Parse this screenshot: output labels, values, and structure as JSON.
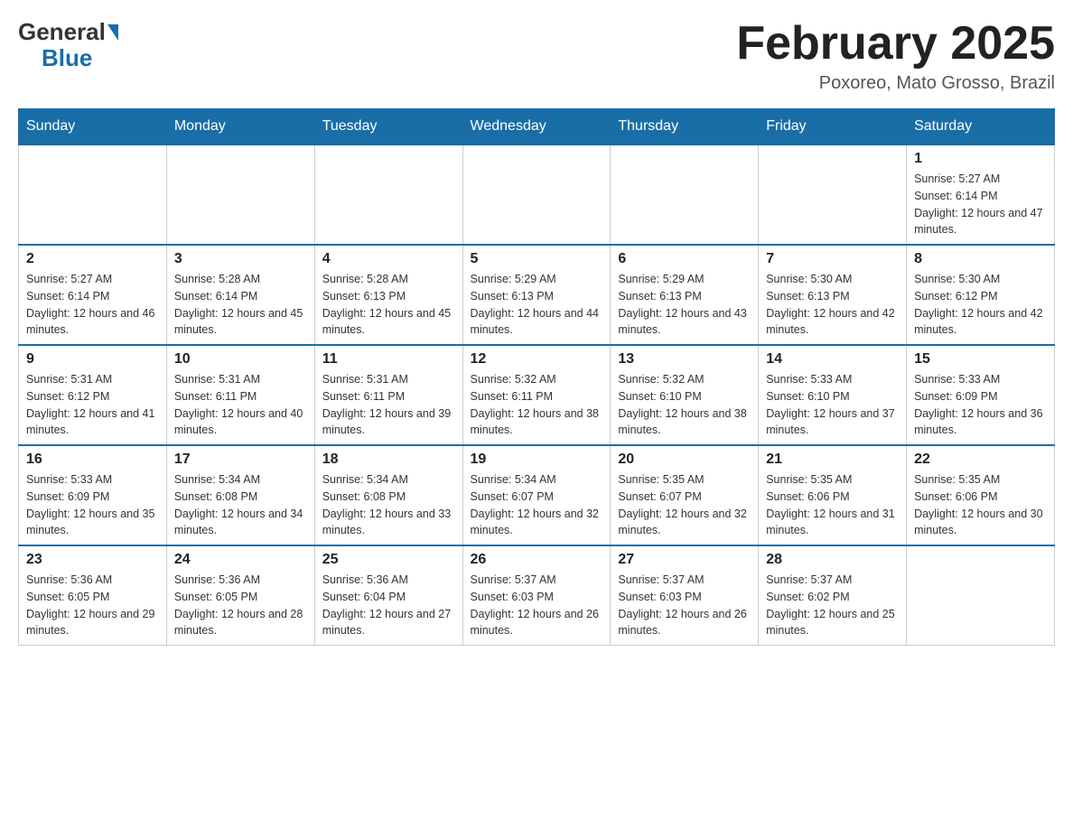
{
  "header": {
    "logo_general": "General",
    "logo_blue": "Blue",
    "title": "February 2025",
    "location": "Poxoreo, Mato Grosso, Brazil"
  },
  "weekdays": [
    "Sunday",
    "Monday",
    "Tuesday",
    "Wednesday",
    "Thursday",
    "Friday",
    "Saturday"
  ],
  "weeks": [
    [
      {
        "day": "",
        "info": ""
      },
      {
        "day": "",
        "info": ""
      },
      {
        "day": "",
        "info": ""
      },
      {
        "day": "",
        "info": ""
      },
      {
        "day": "",
        "info": ""
      },
      {
        "day": "",
        "info": ""
      },
      {
        "day": "1",
        "info": "Sunrise: 5:27 AM\nSunset: 6:14 PM\nDaylight: 12 hours and 47 minutes."
      }
    ],
    [
      {
        "day": "2",
        "info": "Sunrise: 5:27 AM\nSunset: 6:14 PM\nDaylight: 12 hours and 46 minutes."
      },
      {
        "day": "3",
        "info": "Sunrise: 5:28 AM\nSunset: 6:14 PM\nDaylight: 12 hours and 45 minutes."
      },
      {
        "day": "4",
        "info": "Sunrise: 5:28 AM\nSunset: 6:13 PM\nDaylight: 12 hours and 45 minutes."
      },
      {
        "day": "5",
        "info": "Sunrise: 5:29 AM\nSunset: 6:13 PM\nDaylight: 12 hours and 44 minutes."
      },
      {
        "day": "6",
        "info": "Sunrise: 5:29 AM\nSunset: 6:13 PM\nDaylight: 12 hours and 43 minutes."
      },
      {
        "day": "7",
        "info": "Sunrise: 5:30 AM\nSunset: 6:13 PM\nDaylight: 12 hours and 42 minutes."
      },
      {
        "day": "8",
        "info": "Sunrise: 5:30 AM\nSunset: 6:12 PM\nDaylight: 12 hours and 42 minutes."
      }
    ],
    [
      {
        "day": "9",
        "info": "Sunrise: 5:31 AM\nSunset: 6:12 PM\nDaylight: 12 hours and 41 minutes."
      },
      {
        "day": "10",
        "info": "Sunrise: 5:31 AM\nSunset: 6:11 PM\nDaylight: 12 hours and 40 minutes."
      },
      {
        "day": "11",
        "info": "Sunrise: 5:31 AM\nSunset: 6:11 PM\nDaylight: 12 hours and 39 minutes."
      },
      {
        "day": "12",
        "info": "Sunrise: 5:32 AM\nSunset: 6:11 PM\nDaylight: 12 hours and 38 minutes."
      },
      {
        "day": "13",
        "info": "Sunrise: 5:32 AM\nSunset: 6:10 PM\nDaylight: 12 hours and 38 minutes."
      },
      {
        "day": "14",
        "info": "Sunrise: 5:33 AM\nSunset: 6:10 PM\nDaylight: 12 hours and 37 minutes."
      },
      {
        "day": "15",
        "info": "Sunrise: 5:33 AM\nSunset: 6:09 PM\nDaylight: 12 hours and 36 minutes."
      }
    ],
    [
      {
        "day": "16",
        "info": "Sunrise: 5:33 AM\nSunset: 6:09 PM\nDaylight: 12 hours and 35 minutes."
      },
      {
        "day": "17",
        "info": "Sunrise: 5:34 AM\nSunset: 6:08 PM\nDaylight: 12 hours and 34 minutes."
      },
      {
        "day": "18",
        "info": "Sunrise: 5:34 AM\nSunset: 6:08 PM\nDaylight: 12 hours and 33 minutes."
      },
      {
        "day": "19",
        "info": "Sunrise: 5:34 AM\nSunset: 6:07 PM\nDaylight: 12 hours and 32 minutes."
      },
      {
        "day": "20",
        "info": "Sunrise: 5:35 AM\nSunset: 6:07 PM\nDaylight: 12 hours and 32 minutes."
      },
      {
        "day": "21",
        "info": "Sunrise: 5:35 AM\nSunset: 6:06 PM\nDaylight: 12 hours and 31 minutes."
      },
      {
        "day": "22",
        "info": "Sunrise: 5:35 AM\nSunset: 6:06 PM\nDaylight: 12 hours and 30 minutes."
      }
    ],
    [
      {
        "day": "23",
        "info": "Sunrise: 5:36 AM\nSunset: 6:05 PM\nDaylight: 12 hours and 29 minutes."
      },
      {
        "day": "24",
        "info": "Sunrise: 5:36 AM\nSunset: 6:05 PM\nDaylight: 12 hours and 28 minutes."
      },
      {
        "day": "25",
        "info": "Sunrise: 5:36 AM\nSunset: 6:04 PM\nDaylight: 12 hours and 27 minutes."
      },
      {
        "day": "26",
        "info": "Sunrise: 5:37 AM\nSunset: 6:03 PM\nDaylight: 12 hours and 26 minutes."
      },
      {
        "day": "27",
        "info": "Sunrise: 5:37 AM\nSunset: 6:03 PM\nDaylight: 12 hours and 26 minutes."
      },
      {
        "day": "28",
        "info": "Sunrise: 5:37 AM\nSunset: 6:02 PM\nDaylight: 12 hours and 25 minutes."
      },
      {
        "day": "",
        "info": ""
      }
    ]
  ]
}
